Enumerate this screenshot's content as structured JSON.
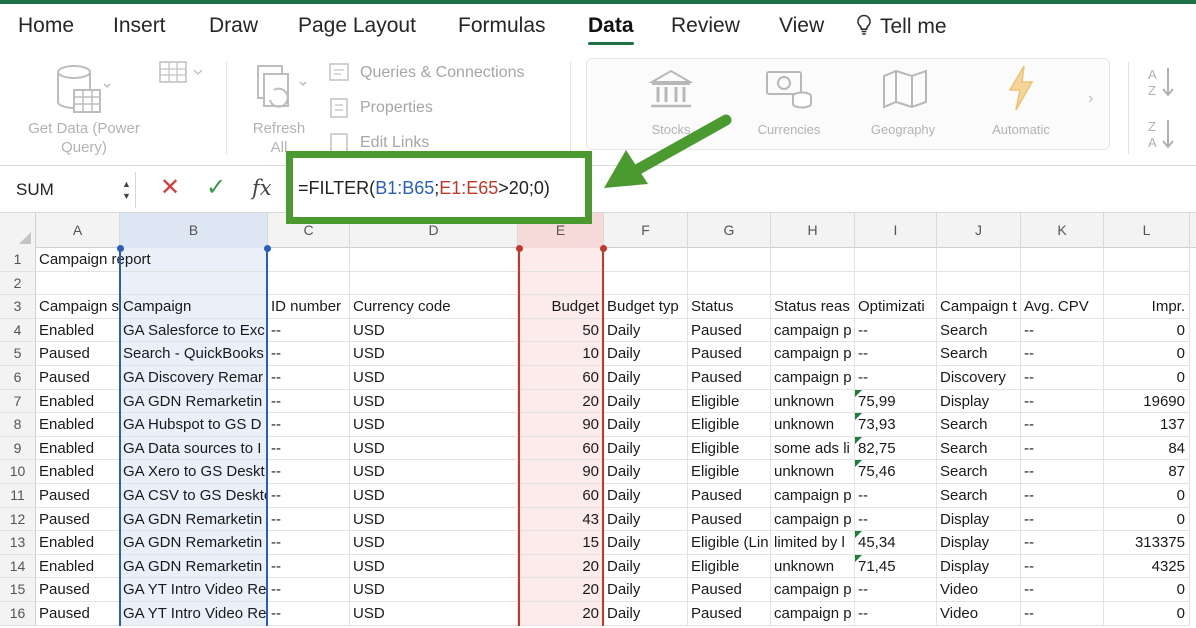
{
  "tabs": [
    "Home",
    "Insert",
    "Draw",
    "Page Layout",
    "Formulas",
    "Data",
    "Review",
    "View"
  ],
  "active_tab": "Data",
  "tell_me": "Tell me",
  "ribbon": {
    "get_data_line1": "Get Data (Power",
    "get_data_line2": "Query)",
    "refresh_line1": "Refresh",
    "refresh_line2": "All",
    "queries_connections": "Queries & Connections",
    "properties": "Properties",
    "edit_links": "Edit Links",
    "data_types": [
      "Stocks",
      "Currencies",
      "Geography",
      "Automatic"
    ],
    "sort_az": "A Z",
    "sort_za": "Z A"
  },
  "formula_bar": {
    "name_box": "SUM",
    "cancel_glyph": "✕",
    "enter_glyph": "✓",
    "fx": "fx",
    "formula_prefix": "=FILTER(",
    "formula_ref1": "B1:B65",
    "formula_sep": ";",
    "formula_ref2": "E1:E65",
    "formula_suffix": ">20;0)"
  },
  "columns": [
    "A",
    "B",
    "C",
    "D",
    "E",
    "F",
    "G",
    "H",
    "I",
    "J",
    "K",
    "L"
  ],
  "row_numbers": [
    "1",
    "2",
    "3",
    "4",
    "5",
    "6",
    "7",
    "8",
    "9",
    "10",
    "11",
    "12",
    "13",
    "14",
    "15",
    "16"
  ],
  "sheet": {
    "title": "Campaign report",
    "headers": [
      "Campaign s",
      "Campaign",
      "ID number",
      "Currency code",
      "Budget",
      "Budget typ",
      "Status",
      "Status reas",
      "Optimizati",
      "Campaign t",
      "Avg. CPV",
      "Impr."
    ],
    "rows": [
      [
        "Enabled",
        "GA Salesforce to Exc",
        "--",
        "USD",
        "50",
        "Daily",
        "Paused",
        "campaign p",
        "--",
        "Search",
        "--",
        "0"
      ],
      [
        "Paused",
        "Search - QuickBooks",
        "--",
        "USD",
        "10",
        "Daily",
        "Paused",
        "campaign p",
        "--",
        "Search",
        "--",
        "0"
      ],
      [
        "Paused",
        "GA Discovery Remar",
        "--",
        "USD",
        "60",
        "Daily",
        "Paused",
        "campaign p",
        "--",
        "Discovery",
        "--",
        "0"
      ],
      [
        "Enabled",
        "GA GDN Remarketin",
        "--",
        "USD",
        "20",
        "Daily",
        "Eligible",
        "unknown",
        "75,99",
        "Display",
        "--",
        "19690"
      ],
      [
        "Enabled",
        "GA Hubspot to GS D",
        "--",
        "USD",
        "90",
        "Daily",
        "Eligible",
        "unknown",
        "73,93",
        "Search",
        "--",
        "137"
      ],
      [
        "Enabled",
        "GA Data sources to I",
        "--",
        "USD",
        "60",
        "Daily",
        "Eligible",
        "some ads li",
        "82,75",
        "Search",
        "--",
        "84"
      ],
      [
        "Enabled",
        "GA Xero to GS Deskt",
        "--",
        "USD",
        "90",
        "Daily",
        "Eligible",
        "unknown",
        "75,46",
        "Search",
        "--",
        "87"
      ],
      [
        "Paused",
        "GA CSV to GS Deskto",
        "--",
        "USD",
        "60",
        "Daily",
        "Paused",
        "campaign p",
        "--",
        "Search",
        "--",
        "0"
      ],
      [
        "Paused",
        "GA GDN Remarketin",
        "--",
        "USD",
        "43",
        "Daily",
        "Paused",
        "campaign p",
        "--",
        "Display",
        "--",
        "0"
      ],
      [
        "Enabled",
        "GA GDN Remarketin",
        "--",
        "USD",
        "15",
        "Daily",
        "Eligible (Lin",
        "limited by l",
        "45,34",
        "Display",
        "--",
        "313375"
      ],
      [
        "Enabled",
        "GA GDN Remarketin",
        "--",
        "USD",
        "20",
        "Daily",
        "Eligible",
        "unknown",
        "71,45",
        "Display",
        "--",
        "4325"
      ],
      [
        "Paused",
        "GA YT Intro Video Re",
        "--",
        "USD",
        "20",
        "Daily",
        "Paused",
        "campaign p",
        "--",
        "Video",
        "--",
        "0"
      ],
      [
        "Paused",
        "GA YT Intro Video Re",
        "--",
        "USD",
        "20",
        "Daily",
        "Paused",
        "campaign p",
        "--",
        "Video",
        "--",
        "0"
      ]
    ],
    "flagged_rows": [
      3,
      4,
      5,
      6,
      9,
      10
    ]
  },
  "colors": {
    "accent_green": "#1e7145",
    "highlight_green": "#4a9a2f",
    "range_blue": "#2a5fb8",
    "range_red": "#c0392b"
  },
  "icons": [
    "lightbulb-icon",
    "database-icon",
    "refresh-icon",
    "stocks-icon",
    "currencies-icon",
    "geography-icon",
    "automatic-icon",
    "sort-icon",
    "arrow-icon"
  ]
}
